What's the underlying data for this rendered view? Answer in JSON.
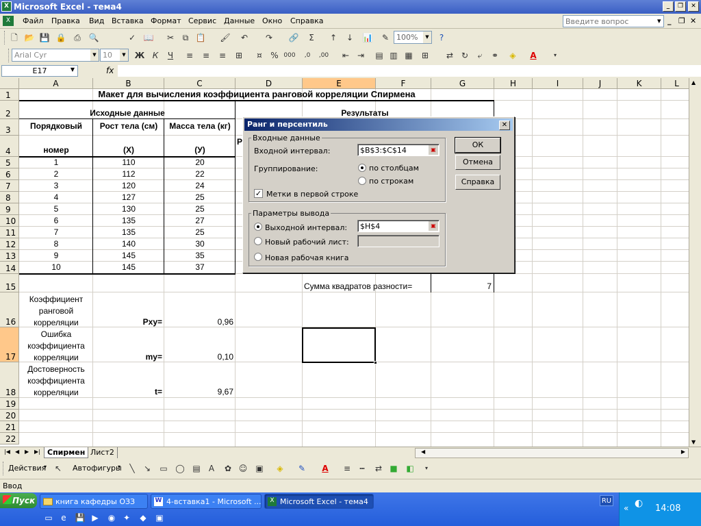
{
  "app": {
    "title": "Microsoft Excel - тема4",
    "icon": "excel-icon"
  },
  "menu": {
    "items": [
      "Файл",
      "Правка",
      "Вид",
      "Вставка",
      "Формат",
      "Сервис",
      "Данные",
      "Окно",
      "Справка"
    ],
    "ask_placeholder": "Введите вопрос"
  },
  "toolbar": {
    "zoom": "100%",
    "font": "Arial Cyr",
    "size": "10"
  },
  "formula": {
    "cell_ref": "E17",
    "fx": "fx",
    "value": ""
  },
  "columns": [
    "A",
    "B",
    "C",
    "D",
    "E",
    "F",
    "G",
    "H",
    "I",
    "J",
    "K",
    "L"
  ],
  "rows": [
    "1",
    "2",
    "3",
    "4",
    "5",
    "6",
    "7",
    "8",
    "9",
    "10",
    "11",
    "12",
    "13",
    "14",
    "15",
    "16",
    "17",
    "18",
    "19",
    "20",
    "21",
    "22"
  ],
  "sheet": {
    "title": "Макет для вычисления коэффициента ранговой корреляции  Спирмена",
    "source_header": "Исходные данные",
    "results_header": "Результаты",
    "results_partial": "Р",
    "col_a_header_1": "Порядковый",
    "col_a_header_2": "номер",
    "col_b_header_1": "Рост  тела  (см)",
    "col_b_header_2": "(X)",
    "col_c_header_1": "Масса тела (кг)",
    "col_c_header_2": "(У)",
    "data": [
      {
        "n": "1",
        "x": "110",
        "y": "20"
      },
      {
        "n": "2",
        "x": "112",
        "y": "22"
      },
      {
        "n": "3",
        "x": "120",
        "y": "24"
      },
      {
        "n": "4",
        "x": "127",
        "y": "25"
      },
      {
        "n": "5",
        "x": "130",
        "y": "25"
      },
      {
        "n": "6",
        "x": "135",
        "y": "27"
      },
      {
        "n": "7",
        "x": "135",
        "y": "25"
      },
      {
        "n": "8",
        "x": "140",
        "y": "30"
      },
      {
        "n": "9",
        "x": "145",
        "y": "35"
      },
      {
        "n": "10",
        "x": "145",
        "y": "37"
      }
    ],
    "sum_sq_label": "Сумма квадратов разности=",
    "sum_sq_value": "7",
    "coef_lines": [
      "Коэффициент",
      "ранговой",
      "корреляции"
    ],
    "coef_symbol": "Pxy=",
    "coef_value": "0,96",
    "err_lines": [
      "Ошибка",
      "коэффициента",
      "корреляции"
    ],
    "err_symbol": "my=",
    "err_value": "0,10",
    "rel_lines": [
      "Достоверность",
      "коэффициента",
      "корреляции"
    ],
    "rel_symbol": "t=",
    "rel_value": "9,67"
  },
  "tabs": [
    "Спирмен",
    "Лист2"
  ],
  "drawing": {
    "actions": "Действия",
    "autoshapes": "Автофигуры"
  },
  "status": "Ввод",
  "dialog": {
    "title": "Ранг и персентиль",
    "input_group": "Входные данные",
    "input_range_label": "Входной интервал:",
    "input_range_value": "$B$3:$C$14",
    "grouping_label": "Группирование:",
    "by_columns": "по столбцам",
    "by_rows": "по строкам",
    "labels_first_row": "Метки в первой строке",
    "output_group": "Параметры вывода",
    "output_range_label": "Выходной интервал:",
    "output_range_value": "$H$4",
    "new_sheet": "Новый рабочий лист:",
    "new_book": "Новая рабочая книга",
    "ok": "ОК",
    "cancel": "Отмена",
    "help": "Справка"
  },
  "taskbar": {
    "start": "Пуск",
    "buttons": [
      "книга кафедры ОЗЗ",
      "4-вставка1 - Microsoft ...",
      "Microsoft Excel - тема4"
    ],
    "lang": "RU",
    "time": "14:08"
  }
}
